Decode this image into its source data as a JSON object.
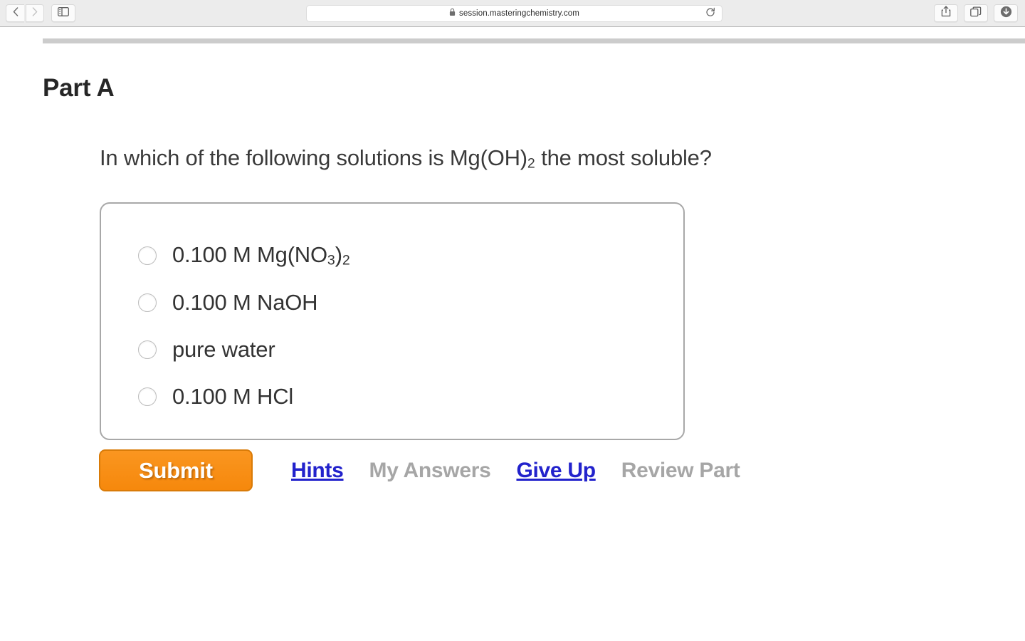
{
  "browser": {
    "back_icon": "chevron-left-icon",
    "forward_icon": "chevron-right-icon",
    "sidebar_icon": "sidebar-toggle-icon",
    "lock_icon": "lock-icon",
    "url": "session.masteringchemistry.com",
    "reload_icon": "reload-icon",
    "share_icon": "share-icon",
    "tabs_icon": "tab-overview-icon",
    "downloads_icon": "downloads-icon"
  },
  "page": {
    "part_title": "Part A",
    "question_prefix": "In which of the following solutions is Mg(OH)",
    "question_sub": "2",
    "question_suffix": " the most soluble?",
    "options": [
      {
        "text_before": "0.100 M Mg(NO",
        "sub1": "3",
        "text_mid": ")",
        "sub2": "2",
        "text_after": "",
        "full": "0.100 M Mg(NO3)2"
      },
      {
        "text_before": "0.100 M NaOH",
        "sub1": "",
        "text_mid": "",
        "sub2": "",
        "text_after": "",
        "full": "0.100 M NaOH"
      },
      {
        "text_before": "pure water",
        "sub1": "",
        "text_mid": "",
        "sub2": "",
        "text_after": "",
        "full": "pure water"
      },
      {
        "text_before": "0.100 M HCl",
        "sub1": "",
        "text_mid": "",
        "sub2": "",
        "text_after": "",
        "full": "0.100 M HCl"
      }
    ],
    "actions": {
      "submit_label": "Submit",
      "hints_label": "Hints",
      "my_answers_label": "My Answers",
      "give_up_label": "Give Up",
      "review_part_label": "Review Part"
    }
  },
  "colors": {
    "submit_orange": "#f6880c",
    "link_blue": "#2222cc",
    "disabled_gray": "#a6a6a6",
    "rule_gray": "#cccccc",
    "box_border": "#a8a8a8"
  }
}
